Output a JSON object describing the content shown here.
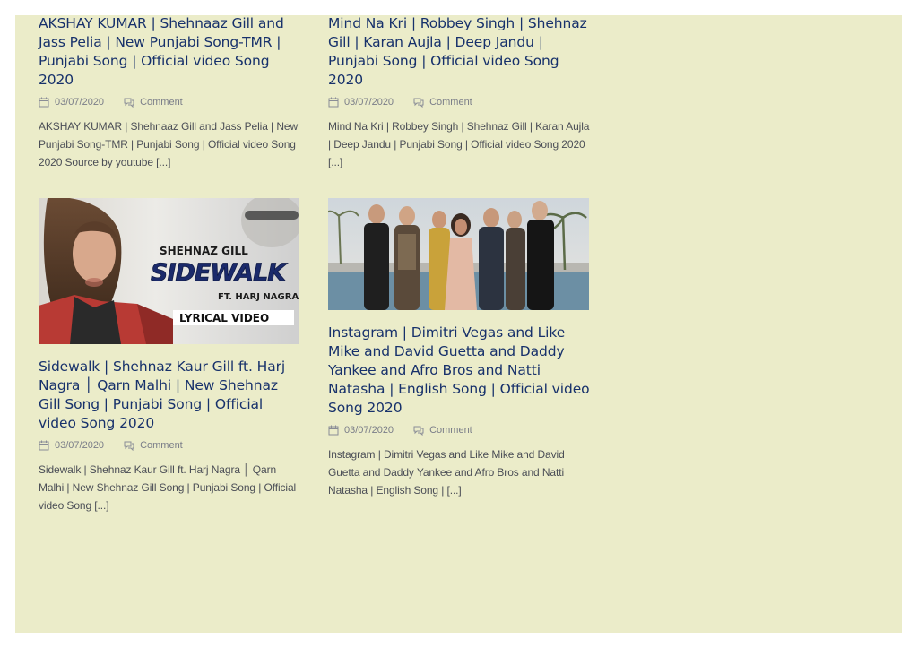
{
  "posts": [
    {
      "title": "AKSHAY KUMAR | Shehnaaz Gill and Jass Pelia | New Punjabi Song-TMR | Punjabi Song | Official video Song 2020",
      "date": "03/07/2020",
      "comment_label": "Comment",
      "excerpt": "AKSHAY KUMAR | Shehnaaz Gill and Jass Pelia | New Punjabi Song-TMR | Punjabi Song | Official video Song 2020 Source by youtube [...]"
    },
    {
      "title": "Mind Na Kri | Robbey Singh | Shehnaz Gill | Karan Aujla | Deep Jandu | Punjabi Song | Official video Song 2020",
      "date": "03/07/2020",
      "comment_label": "Comment",
      "excerpt": "Mind Na Kri | Robbey Singh | Shehnaz Gill | Karan Aujla | Deep Jandu | Punjabi Song | Official video Song 2020 [...]"
    },
    {
      "thumb": {
        "artist": "SHEHNAZ GILL",
        "song": "SIDEWALK",
        "feat": "FT. HARJ NAGRA",
        "tag": "LYRICAL VIDEO"
      },
      "title": "Sidewalk | Shehnaz Kaur Gill ft. Harj Nagra │ Qarn Malhi | New Shehnaz Gill Song | Punjabi Song | Official video Song 2020",
      "date": "03/07/2020",
      "comment_label": "Comment",
      "excerpt": "Sidewalk | Shehnaz Kaur Gill ft. Harj Nagra │ Qarn Malhi | New Shehnaz Gill Song | Punjabi Song | Official video Song [...]"
    },
    {
      "title": "Instagram | Dimitri Vegas and Like Mike and David Guetta and Daddy Yankee and Afro Bros and Natti Natasha | English Song | Official video Song 2020",
      "date": "03/07/2020",
      "comment_label": "Comment",
      "excerpt": "Instagram | Dimitri Vegas and Like Mike and David Guetta and Daddy Yankee and Afro Bros and Natti Natasha | English Song | [...]"
    }
  ],
  "colors": {
    "panel_bg": "#ebecc9",
    "title": "#17316b",
    "meta": "#7a7d88",
    "excerpt": "#4b4e56"
  }
}
